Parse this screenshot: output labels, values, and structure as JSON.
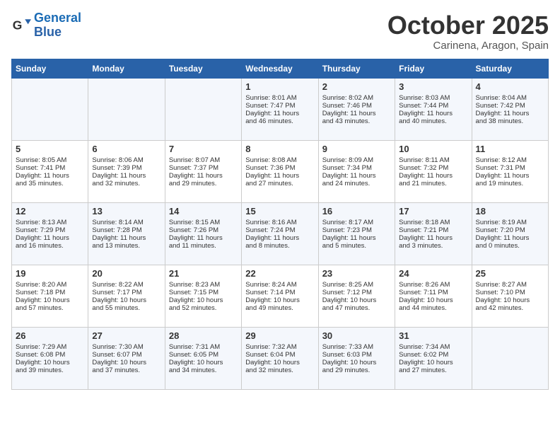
{
  "header": {
    "logo_line1": "General",
    "logo_line2": "Blue",
    "month": "October 2025",
    "location": "Carinena, Aragon, Spain"
  },
  "weekdays": [
    "Sunday",
    "Monday",
    "Tuesday",
    "Wednesday",
    "Thursday",
    "Friday",
    "Saturday"
  ],
  "weeks": [
    [
      {
        "day": "",
        "info": ""
      },
      {
        "day": "",
        "info": ""
      },
      {
        "day": "",
        "info": ""
      },
      {
        "day": "1",
        "info": "Sunrise: 8:01 AM\nSunset: 7:47 PM\nDaylight: 11 hours\nand 46 minutes."
      },
      {
        "day": "2",
        "info": "Sunrise: 8:02 AM\nSunset: 7:46 PM\nDaylight: 11 hours\nand 43 minutes."
      },
      {
        "day": "3",
        "info": "Sunrise: 8:03 AM\nSunset: 7:44 PM\nDaylight: 11 hours\nand 40 minutes."
      },
      {
        "day": "4",
        "info": "Sunrise: 8:04 AM\nSunset: 7:42 PM\nDaylight: 11 hours\nand 38 minutes."
      }
    ],
    [
      {
        "day": "5",
        "info": "Sunrise: 8:05 AM\nSunset: 7:41 PM\nDaylight: 11 hours\nand 35 minutes."
      },
      {
        "day": "6",
        "info": "Sunrise: 8:06 AM\nSunset: 7:39 PM\nDaylight: 11 hours\nand 32 minutes."
      },
      {
        "day": "7",
        "info": "Sunrise: 8:07 AM\nSunset: 7:37 PM\nDaylight: 11 hours\nand 29 minutes."
      },
      {
        "day": "8",
        "info": "Sunrise: 8:08 AM\nSunset: 7:36 PM\nDaylight: 11 hours\nand 27 minutes."
      },
      {
        "day": "9",
        "info": "Sunrise: 8:09 AM\nSunset: 7:34 PM\nDaylight: 11 hours\nand 24 minutes."
      },
      {
        "day": "10",
        "info": "Sunrise: 8:11 AM\nSunset: 7:32 PM\nDaylight: 11 hours\nand 21 minutes."
      },
      {
        "day": "11",
        "info": "Sunrise: 8:12 AM\nSunset: 7:31 PM\nDaylight: 11 hours\nand 19 minutes."
      }
    ],
    [
      {
        "day": "12",
        "info": "Sunrise: 8:13 AM\nSunset: 7:29 PM\nDaylight: 11 hours\nand 16 minutes."
      },
      {
        "day": "13",
        "info": "Sunrise: 8:14 AM\nSunset: 7:28 PM\nDaylight: 11 hours\nand 13 minutes."
      },
      {
        "day": "14",
        "info": "Sunrise: 8:15 AM\nSunset: 7:26 PM\nDaylight: 11 hours\nand 11 minutes."
      },
      {
        "day": "15",
        "info": "Sunrise: 8:16 AM\nSunset: 7:24 PM\nDaylight: 11 hours\nand 8 minutes."
      },
      {
        "day": "16",
        "info": "Sunrise: 8:17 AM\nSunset: 7:23 PM\nDaylight: 11 hours\nand 5 minutes."
      },
      {
        "day": "17",
        "info": "Sunrise: 8:18 AM\nSunset: 7:21 PM\nDaylight: 11 hours\nand 3 minutes."
      },
      {
        "day": "18",
        "info": "Sunrise: 8:19 AM\nSunset: 7:20 PM\nDaylight: 11 hours\nand 0 minutes."
      }
    ],
    [
      {
        "day": "19",
        "info": "Sunrise: 8:20 AM\nSunset: 7:18 PM\nDaylight: 10 hours\nand 57 minutes."
      },
      {
        "day": "20",
        "info": "Sunrise: 8:22 AM\nSunset: 7:17 PM\nDaylight: 10 hours\nand 55 minutes."
      },
      {
        "day": "21",
        "info": "Sunrise: 8:23 AM\nSunset: 7:15 PM\nDaylight: 10 hours\nand 52 minutes."
      },
      {
        "day": "22",
        "info": "Sunrise: 8:24 AM\nSunset: 7:14 PM\nDaylight: 10 hours\nand 49 minutes."
      },
      {
        "day": "23",
        "info": "Sunrise: 8:25 AM\nSunset: 7:12 PM\nDaylight: 10 hours\nand 47 minutes."
      },
      {
        "day": "24",
        "info": "Sunrise: 8:26 AM\nSunset: 7:11 PM\nDaylight: 10 hours\nand 44 minutes."
      },
      {
        "day": "25",
        "info": "Sunrise: 8:27 AM\nSunset: 7:10 PM\nDaylight: 10 hours\nand 42 minutes."
      }
    ],
    [
      {
        "day": "26",
        "info": "Sunrise: 7:29 AM\nSunset: 6:08 PM\nDaylight: 10 hours\nand 39 minutes."
      },
      {
        "day": "27",
        "info": "Sunrise: 7:30 AM\nSunset: 6:07 PM\nDaylight: 10 hours\nand 37 minutes."
      },
      {
        "day": "28",
        "info": "Sunrise: 7:31 AM\nSunset: 6:05 PM\nDaylight: 10 hours\nand 34 minutes."
      },
      {
        "day": "29",
        "info": "Sunrise: 7:32 AM\nSunset: 6:04 PM\nDaylight: 10 hours\nand 32 minutes."
      },
      {
        "day": "30",
        "info": "Sunrise: 7:33 AM\nSunset: 6:03 PM\nDaylight: 10 hours\nand 29 minutes."
      },
      {
        "day": "31",
        "info": "Sunrise: 7:34 AM\nSunset: 6:02 PM\nDaylight: 10 hours\nand 27 minutes."
      },
      {
        "day": "",
        "info": ""
      }
    ]
  ]
}
